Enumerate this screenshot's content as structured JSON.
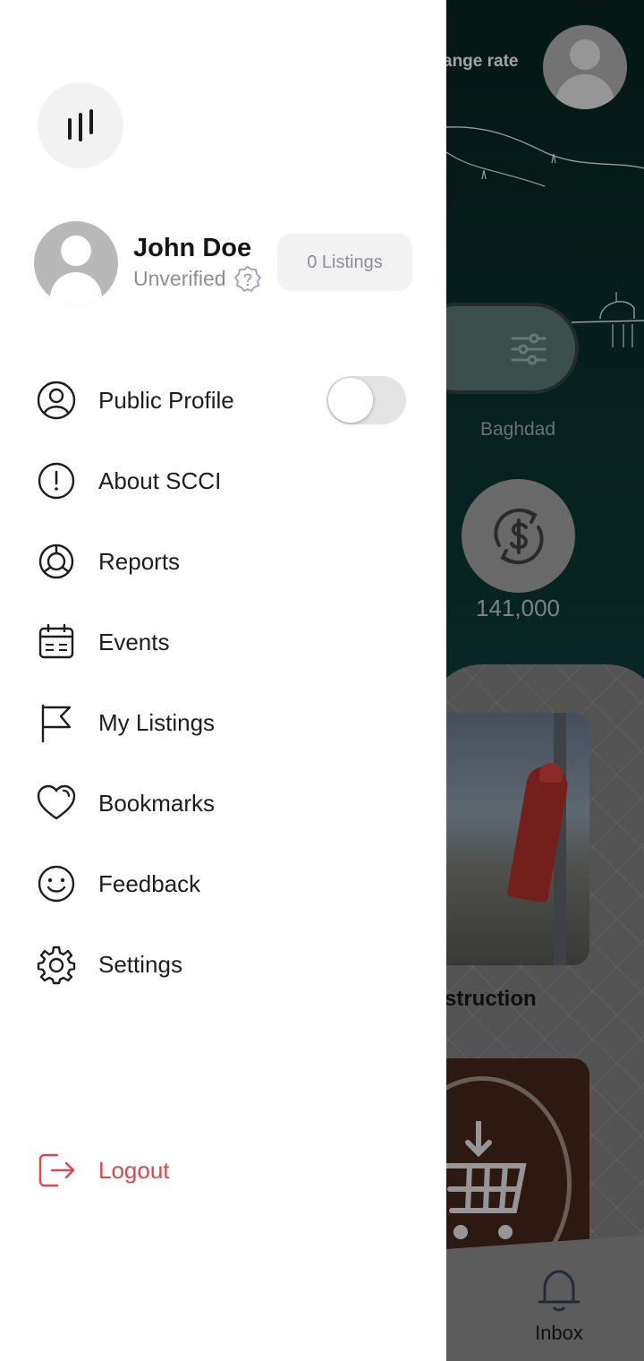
{
  "drawer": {
    "user": {
      "name": "John Doe",
      "status": "Unverified",
      "listings_label": "0 Listings"
    },
    "public_profile": {
      "label": "Public Profile",
      "enabled": false
    },
    "menu": [
      {
        "label": "About SCCI",
        "icon": "info-circle-icon"
      },
      {
        "label": "Reports",
        "icon": "reports-icon"
      },
      {
        "label": "Events",
        "icon": "calendar-icon"
      },
      {
        "label": "My Listings",
        "icon": "flag-icon"
      },
      {
        "label": "Bookmarks",
        "icon": "heart-icon"
      },
      {
        "label": "Feedback",
        "icon": "smiley-icon"
      },
      {
        "label": "Settings",
        "icon": "gear-icon"
      }
    ],
    "logout": {
      "label": "Logout",
      "color": "#e0464a"
    }
  },
  "background": {
    "rate_fragment": "ange rate",
    "city": "Baghdad",
    "amount": "141,000",
    "card_title_fragment": "struction",
    "nav": {
      "inbox_label": "Inbox"
    },
    "header_color": "#062a26"
  }
}
